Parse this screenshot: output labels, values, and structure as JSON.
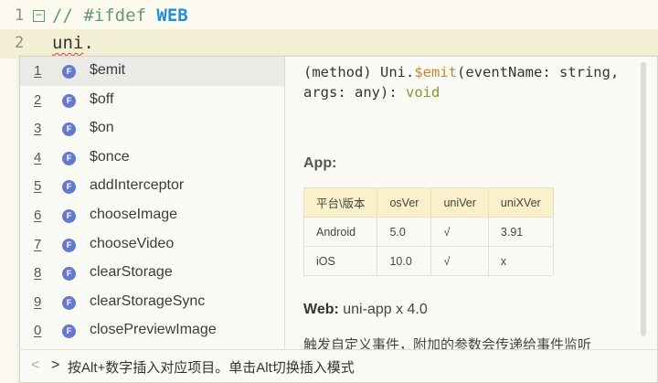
{
  "editor": {
    "lines": [
      {
        "number": "1",
        "fold": "⊟",
        "comment": "// #ifdef ",
        "keyword": "WEB"
      },
      {
        "number": "2",
        "code_error": "uni",
        "code_rest": "."
      }
    ]
  },
  "completion": {
    "selected_index": 0,
    "items": [
      {
        "num": "1",
        "kind": "F",
        "label": "$emit"
      },
      {
        "num": "2",
        "kind": "F",
        "label": "$off"
      },
      {
        "num": "3",
        "kind": "F",
        "label": "$on"
      },
      {
        "num": "4",
        "kind": "F",
        "label": "$once"
      },
      {
        "num": "5",
        "kind": "F",
        "label": "addInterceptor"
      },
      {
        "num": "6",
        "kind": "F",
        "label": "chooseImage"
      },
      {
        "num": "7",
        "kind": "F",
        "label": "chooseVideo"
      },
      {
        "num": "8",
        "kind": "F",
        "label": "clearStorage"
      },
      {
        "num": "9",
        "kind": "F",
        "label": "clearStorageSync"
      },
      {
        "num": "0",
        "kind": "F",
        "label": "closePreviewImage"
      }
    ]
  },
  "docs": {
    "sig_prefix": "(method) Uni.",
    "sig_name": "$emit",
    "sig_params": "(eventName: string, args: any): ",
    "sig_return": "void",
    "app_title": "App:",
    "table": {
      "header": [
        "平台\\版本",
        "osVer",
        "uniVer",
        "uniXVer"
      ],
      "rows": [
        [
          "Android",
          "5.0",
          "√",
          "3.91"
        ],
        [
          "iOS",
          "10.0",
          "√",
          "x"
        ]
      ]
    },
    "web_label": "Web:",
    "web_value": " uni-app x 4.0",
    "description": "触发自定义事件，附加的参数会传递给事件监听"
  },
  "status": {
    "prev": "<",
    "next": ">",
    "hint": "按Alt+数字插入对应项目。单击Alt切换插入模式"
  },
  "colors": {
    "badge": "#6678cf",
    "keyword": "#1d8fd8",
    "comment": "#5f9b6e",
    "table_header": "#faf0c9"
  }
}
